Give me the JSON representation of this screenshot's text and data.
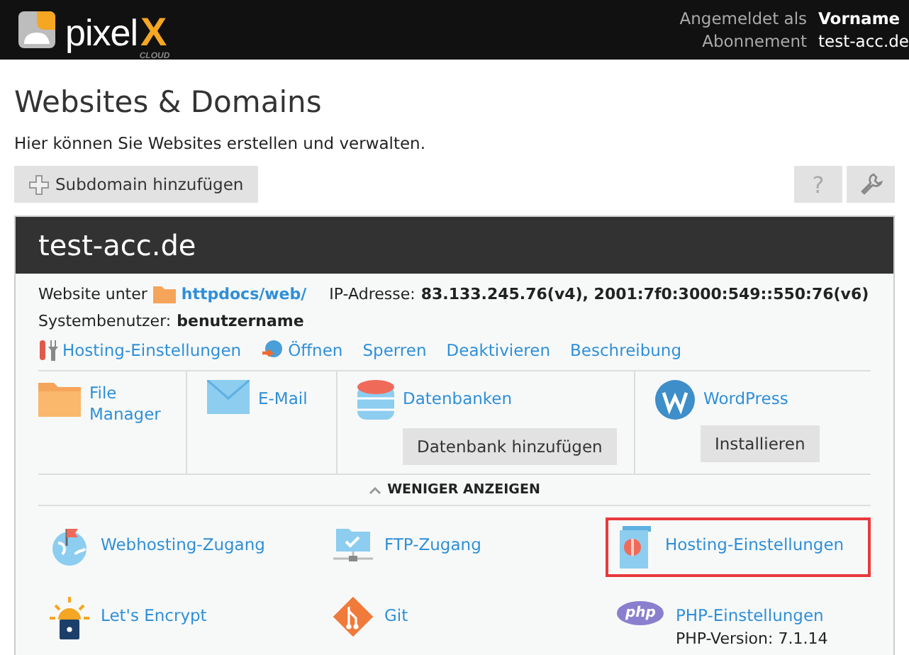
{
  "logo": {
    "word": "pixel",
    "mark": "X",
    "sub": "CLOUD"
  },
  "account": [
    {
      "label": "Angemeldet als",
      "value": "Vorname"
    },
    {
      "label": "Abonnement",
      "value": "test-acc.de"
    }
  ],
  "page": {
    "title": "Websites & Domains",
    "subtitle": "Hier können Sie Websites erstellen und verwalten."
  },
  "toolbar": {
    "add_button": "Subdomain hinzufügen",
    "help_button": "?"
  },
  "domain": {
    "name": "test-acc.de",
    "website_label": "Website unter",
    "website_path": "httpdocs/web/",
    "ip_label": "IP-Adresse:",
    "ip_value": "83.133.245.76(v4), 2001:7f0:3000:549::550:76(v6)",
    "user_label": "Systembenutzer:",
    "user_value": "benutzername",
    "actions": [
      {
        "label": "Hosting-Einstellungen",
        "kind": "tools"
      },
      {
        "label": "Öffnen",
        "kind": "open"
      },
      {
        "label": "Sperren",
        "kind": "none"
      },
      {
        "label": "Deaktivieren",
        "kind": "none"
      },
      {
        "label": "Beschreibung",
        "kind": "none"
      }
    ],
    "apps": [
      {
        "label": "File Manager",
        "kind": "folder"
      },
      {
        "label": "E-Mail",
        "kind": "mail"
      },
      {
        "label": "Datenbanken",
        "kind": "database",
        "button": "Datenbank hinzufügen"
      },
      {
        "label": "WordPress",
        "kind": "wordpress",
        "button": "Installieren"
      }
    ],
    "toggle": "WENIGER ANZEIGEN",
    "tools": [
      {
        "label": "Webhosting-Zugang",
        "kind": "globe",
        "highlighted": false
      },
      {
        "label": "FTP-Zugang",
        "kind": "ftp",
        "highlighted": false
      },
      {
        "label": "Hosting-Einstellungen",
        "kind": "scroll",
        "highlighted": true
      },
      {
        "label": "Let's Encrypt",
        "kind": "lock",
        "highlighted": false
      },
      {
        "label": "Git",
        "kind": "git",
        "highlighted": false
      },
      {
        "label": "PHP-Einstellungen",
        "kind": "php",
        "icon_text": "php",
        "note": "PHP-Version: 7.1.14",
        "highlighted": false
      }
    ]
  }
}
